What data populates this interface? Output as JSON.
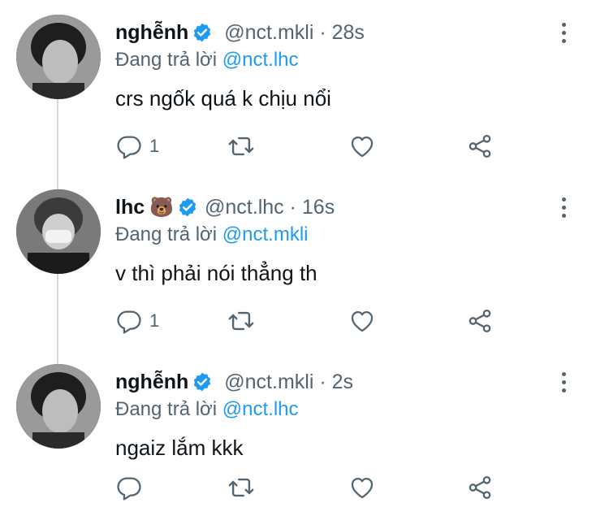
{
  "tweets": [
    {
      "name": "nghễnh",
      "emoji": "",
      "handle": "@nct.mkli",
      "time": "28s",
      "reply_prefix": "Đang trả lời",
      "reply_to": "@nct.lhc",
      "text": "crs ngốk quá k chịu nổi",
      "reply_count": "1"
    },
    {
      "name": "lhc",
      "emoji": "🐻",
      "handle": "@nct.lhc",
      "time": "16s",
      "reply_prefix": "Đang trả lời",
      "reply_to": "@nct.mkli",
      "text": "v thì phải nói thẳng th",
      "reply_count": "1"
    },
    {
      "name": "nghễnh",
      "emoji": "",
      "handle": "@nct.mkli",
      "time": "2s",
      "reply_prefix": "Đang trả lời",
      "reply_to": "@nct.lhc",
      "text": "ngaiz lắm kkk",
      "reply_count": ""
    }
  ],
  "separator": "·",
  "icons": [
    "verified-badge-icon",
    "reply-icon",
    "retweet-icon",
    "like-icon",
    "share-icon",
    "more-icon"
  ],
  "colors": {
    "accent": "#1d9bf0",
    "muted": "#536471",
    "text": "#0f1419"
  }
}
